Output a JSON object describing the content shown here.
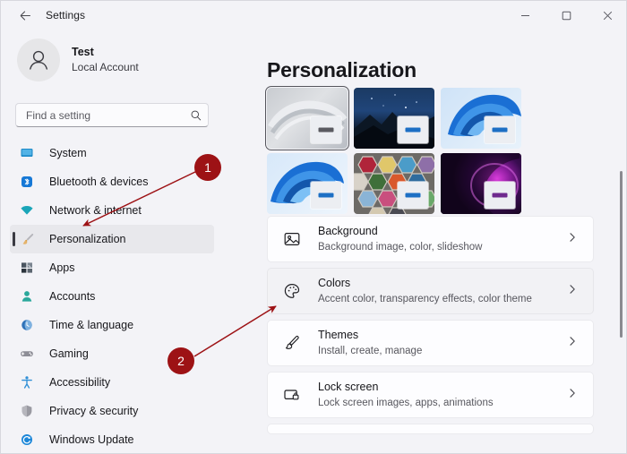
{
  "window": {
    "title": "Settings",
    "back_icon": "back-arrow-icon",
    "controls": {
      "minimize": "minimize-icon",
      "maximize": "maximize-icon",
      "close": "close-icon"
    }
  },
  "account": {
    "name": "Test",
    "subtitle": "Local Account",
    "avatar_icon": "person-avatar-icon"
  },
  "search": {
    "placeholder": "Find a setting",
    "value": "",
    "icon": "search-icon"
  },
  "sidebar": {
    "items": [
      {
        "label": "System",
        "icon": "monitor-icon",
        "selected": false,
        "color": "#1e8bc9"
      },
      {
        "label": "Bluetooth & devices",
        "icon": "bluetooth-icon",
        "selected": false,
        "color": "#1678d6"
      },
      {
        "label": "Network & internet",
        "icon": "wifi-icon",
        "selected": false,
        "color": "#1aa5b8"
      },
      {
        "label": "Personalization",
        "icon": "paintbrush-icon",
        "selected": true,
        "color": "#d79a3c"
      },
      {
        "label": "Apps",
        "icon": "apps-grid-icon",
        "selected": false,
        "color": "#4a5560"
      },
      {
        "label": "Accounts",
        "icon": "person-icon",
        "selected": false,
        "color": "#2aa79b"
      },
      {
        "label": "Time & language",
        "icon": "clock-globe-icon",
        "selected": false,
        "color": "#2f72b8"
      },
      {
        "label": "Gaming",
        "icon": "gamepad-icon",
        "selected": false,
        "color": "#8d8d96"
      },
      {
        "label": "Accessibility",
        "icon": "accessibility-icon",
        "selected": false,
        "color": "#2f8fd6"
      },
      {
        "label": "Privacy & security",
        "icon": "shield-icon",
        "selected": false,
        "color": "#8d8d96"
      },
      {
        "label": "Windows Update",
        "icon": "update-icon",
        "selected": false,
        "color": "#1b86d8"
      }
    ]
  },
  "main": {
    "page_title": "Personalization",
    "themes": [
      {
        "name": "theme-thumbnail-flow-light",
        "selected": true,
        "accent": "#5a5a60"
      },
      {
        "name": "theme-thumbnail-night-mountain",
        "selected": false,
        "accent": "#1d6fc4"
      },
      {
        "name": "theme-thumbnail-bloom-blue",
        "selected": false,
        "accent": "#1d6fc4"
      },
      {
        "name": "theme-thumbnail-bloom-light",
        "selected": false,
        "accent": "#1d6fc4"
      },
      {
        "name": "theme-thumbnail-hexagon-yarn",
        "selected": false,
        "accent": "#1d6fc4"
      },
      {
        "name": "theme-thumbnail-glow-purple",
        "selected": false,
        "accent": "#6e2a8e"
      }
    ],
    "settings": [
      {
        "title": "Background",
        "subtitle": "Background image, color, slideshow",
        "icon": "picture-icon",
        "hovered": false,
        "chevron": "chevron-right-icon"
      },
      {
        "title": "Colors",
        "subtitle": "Accent color, transparency effects, color theme",
        "icon": "palette-icon",
        "hovered": true,
        "chevron": "chevron-right-icon"
      },
      {
        "title": "Themes",
        "subtitle": "Install, create, manage",
        "icon": "brush-icon",
        "hovered": false,
        "chevron": "chevron-right-icon"
      },
      {
        "title": "Lock screen",
        "subtitle": "Lock screen images, apps, animations",
        "icon": "lock-screen-icon",
        "hovered": false,
        "chevron": "chevron-right-icon"
      }
    ]
  },
  "annotations": {
    "color": "#9d1215",
    "markers": [
      {
        "label": "1",
        "target": "Personalization sidebar item"
      },
      {
        "label": "2",
        "target": "Colors settings card"
      }
    ]
  }
}
